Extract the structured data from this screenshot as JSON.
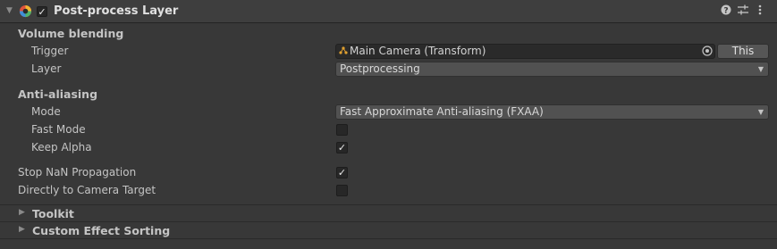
{
  "header": {
    "title": "Post-process Layer",
    "enabled": true,
    "icons": [
      "foldout-arrow-down",
      "post-process-icon",
      "help-icon",
      "preset-icon",
      "more-menu-icon"
    ]
  },
  "volume_blending": {
    "section_label": "Volume blending",
    "trigger_label": "Trigger",
    "trigger_value": "Main Camera (Transform)",
    "this_button": "This",
    "layer_label": "Layer",
    "layer_value": "Postprocessing"
  },
  "anti_aliasing": {
    "section_label": "Anti-aliasing",
    "mode_label": "Mode",
    "mode_value": "Fast Approximate Anti-aliasing (FXAA)",
    "fast_mode_label": "Fast Mode",
    "fast_mode": false,
    "keep_alpha_label": "Keep Alpha",
    "keep_alpha": true
  },
  "stop_nan_label": "Stop NaN Propagation",
  "stop_nan": true,
  "directly_label": "Directly to Camera Target",
  "directly": false,
  "foldouts": {
    "toolkit": "Toolkit",
    "custom_sorting": "Custom Effect Sorting"
  }
}
